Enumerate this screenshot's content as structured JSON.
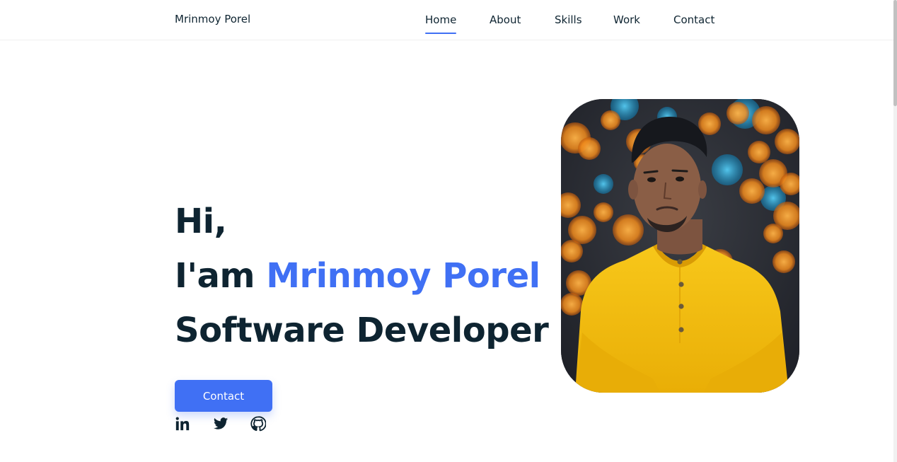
{
  "header": {
    "brand": "Mrinmoy Porel",
    "nav": [
      {
        "label": "Home",
        "active": true
      },
      {
        "label": "About",
        "active": false
      },
      {
        "label": "Skills",
        "active": false
      },
      {
        "label": "Work",
        "active": false
      },
      {
        "label": "Contact",
        "active": false
      }
    ]
  },
  "hero": {
    "greeting": "Hi,",
    "intro_prefix": "I'am",
    "name": "Mrinmoy Porel",
    "role": "Software Developer",
    "contact_button": "Contact",
    "social_icons": [
      "linkedin-icon",
      "twitter-icon",
      "github-icon"
    ]
  },
  "colors": {
    "accent": "#4070f4",
    "text": "#0e2431",
    "shirt": "#f6c20f"
  }
}
